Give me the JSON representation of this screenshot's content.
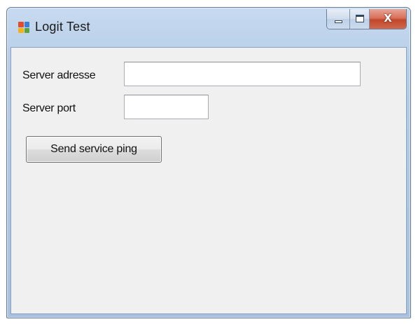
{
  "window": {
    "title": "Logit Test",
    "caption_buttons": {
      "minimize_icon": "minimize-icon",
      "maximize_icon": "maximize-icon",
      "close_glyph": "X"
    }
  },
  "form": {
    "server_address_label": "Server adresse",
    "server_address_value": "",
    "server_port_label": "Server port",
    "server_port_value": "",
    "send_ping_button_label": "Send service ping"
  },
  "colors": {
    "client_background": "#f0f0f0",
    "close_button": "#c2462b",
    "title_bar": "#b7cde8"
  }
}
